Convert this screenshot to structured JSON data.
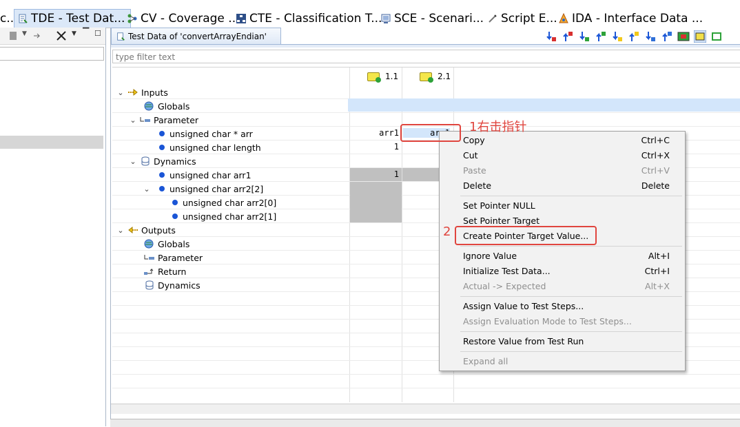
{
  "perspective_tabs": [
    {
      "label": "c..."
    },
    {
      "label": "TDE - Test Dat..."
    },
    {
      "label": "CV - Coverage ..."
    },
    {
      "label": "CTE - Classification T..."
    },
    {
      "label": "SCE - Scenari..."
    },
    {
      "label": "Script E..."
    },
    {
      "label": "IDA - Interface Data ..."
    }
  ],
  "editor": {
    "tab_title": "Test Data of 'convertArrayEndian'",
    "filter_placeholder": "type filter text"
  },
  "columns": [
    "1.1",
    "2.1"
  ],
  "tree": [
    {
      "label": "Inputs"
    },
    {
      "label": "Globals"
    },
    {
      "label": "Parameter"
    },
    {
      "label": "unsigned char * arr",
      "v1": "arr1",
      "v2": "arr1"
    },
    {
      "label": "unsigned char length",
      "v1": "1"
    },
    {
      "label": "Dynamics"
    },
    {
      "label": "unsigned char arr1",
      "v1": "1"
    },
    {
      "label": "unsigned char arr2[2]"
    },
    {
      "label": "unsigned char  arr2[0]"
    },
    {
      "label": "unsigned char  arr2[1]"
    },
    {
      "label": "Outputs"
    },
    {
      "label": "Globals"
    },
    {
      "label": "Parameter"
    },
    {
      "label": "Return"
    },
    {
      "label": "Dynamics"
    }
  ],
  "context_menu": {
    "items": [
      {
        "label": "Copy",
        "shortcut": "Ctrl+C"
      },
      {
        "label": "Cut",
        "shortcut": "Ctrl+X"
      },
      {
        "label": "Paste",
        "shortcut": "Ctrl+V"
      },
      {
        "label": "Delete",
        "shortcut": "Delete"
      },
      {
        "label": "Set Pointer NULL",
        "shortcut": ""
      },
      {
        "label": "Set Pointer Target",
        "shortcut": ""
      },
      {
        "label": "Create Pointer Target Value...",
        "shortcut": ""
      },
      {
        "label": "Ignore Value",
        "shortcut": "Alt+I"
      },
      {
        "label": "Initialize Test Data...",
        "shortcut": "Ctrl+I"
      },
      {
        "label": "Actual -> Expected",
        "shortcut": "Alt+X"
      },
      {
        "label": "Assign Value to Test Steps...",
        "shortcut": ""
      },
      {
        "label": "Assign Evaluation Mode to Test Steps...",
        "shortcut": ""
      },
      {
        "label": "Restore Value from Test Run",
        "shortcut": ""
      },
      {
        "label": "Expand all",
        "shortcut": ""
      }
    ]
  },
  "annotations": {
    "step1": "1右击指针",
    "step2": "2"
  }
}
